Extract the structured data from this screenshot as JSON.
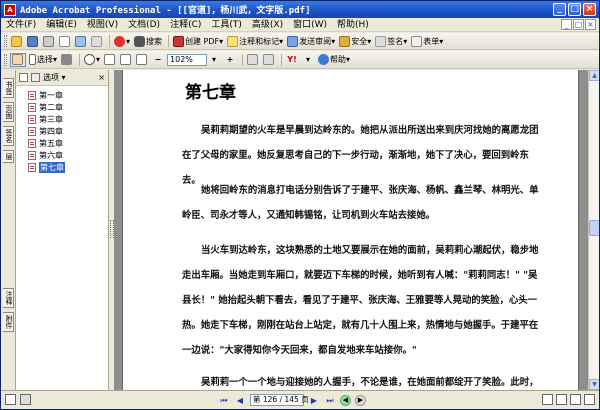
{
  "window": {
    "title": "Adobe Acrobat Professional - [[官道]，杨川武，文字版.pdf]",
    "app_icon": "A"
  },
  "menu": {
    "items": [
      "文件(F)",
      "编辑(E)",
      "视图(V)",
      "文档(D)",
      "注释(C)",
      "工具(T)",
      "高级(X)",
      "窗口(W)",
      "帮助(H)"
    ]
  },
  "toolbar1": {
    "create_pdf": "创建 PDF",
    "comment_mark": "注释和标记",
    "send_review": "发送审阅",
    "security": "安全",
    "sign": "签名",
    "form": "表单",
    "search": "搜索"
  },
  "toolbar2": {
    "select": "选择",
    "zoom": "102%",
    "help": "帮助"
  },
  "nav_tabs": [
    "书签",
    "页面",
    "签名",
    "层",
    "注释",
    "附件"
  ],
  "bookmarks": {
    "options_label": "选项",
    "items": [
      {
        "label": "第一章"
      },
      {
        "label": "第二章"
      },
      {
        "label": "第三章"
      },
      {
        "label": "第四章"
      },
      {
        "label": "第五章"
      },
      {
        "label": "第六章"
      },
      {
        "label": "第七章"
      }
    ]
  },
  "document": {
    "chapter_title": "第七章",
    "paragraphs": [
      "吴莉莉期望的火车是早晨到达岭东的。她把从派出所送出来到庆河找她的离愿龙团在了父母的家里。她反复思考自己的下一步行动，渐渐地，她下了决心，要回到岭东去。",
      "她将回岭东的消息打电话分别告诉了于建平、张庆海、杨帆、鑫兰琴、林明光、单岭臣、司永才等人，又通知韩锡铭，让司机到火车站去接她。",
      "当火车到达岭东，这块熟悉的土地又要展示在她的面前，吴莉莉心潮起伏，稳步地走出车厢。当她走到车厢口，就要迈下车梯的时候，她听到有人喊：\"莉莉同志！\" \"吴县长！\" 她抬起头朝下看去，看见了于建平、张庆海、王雅要等人晃动的笑脸，心头一热。她走下车梯，刚刚在站台上站定，就有几十人围上来，热情地与她握手。于建平在一边说：\"大家得知你今天回来，都自发地来车站接你。\"",
      "吴莉莉一个一个地与迎接她的人握手，不论是谁，在她面前都绽开了笑脸。此时，"
    ]
  },
  "pagination": {
    "current": "第 126",
    "total": "145 页"
  },
  "icons": {
    "first": "first-page-icon",
    "prev": "prev-page-icon",
    "next": "next-page-icon",
    "last": "last-page-icon"
  },
  "colors": {
    "titlebar": "#1a52c8",
    "selected": "#316ac5"
  }
}
